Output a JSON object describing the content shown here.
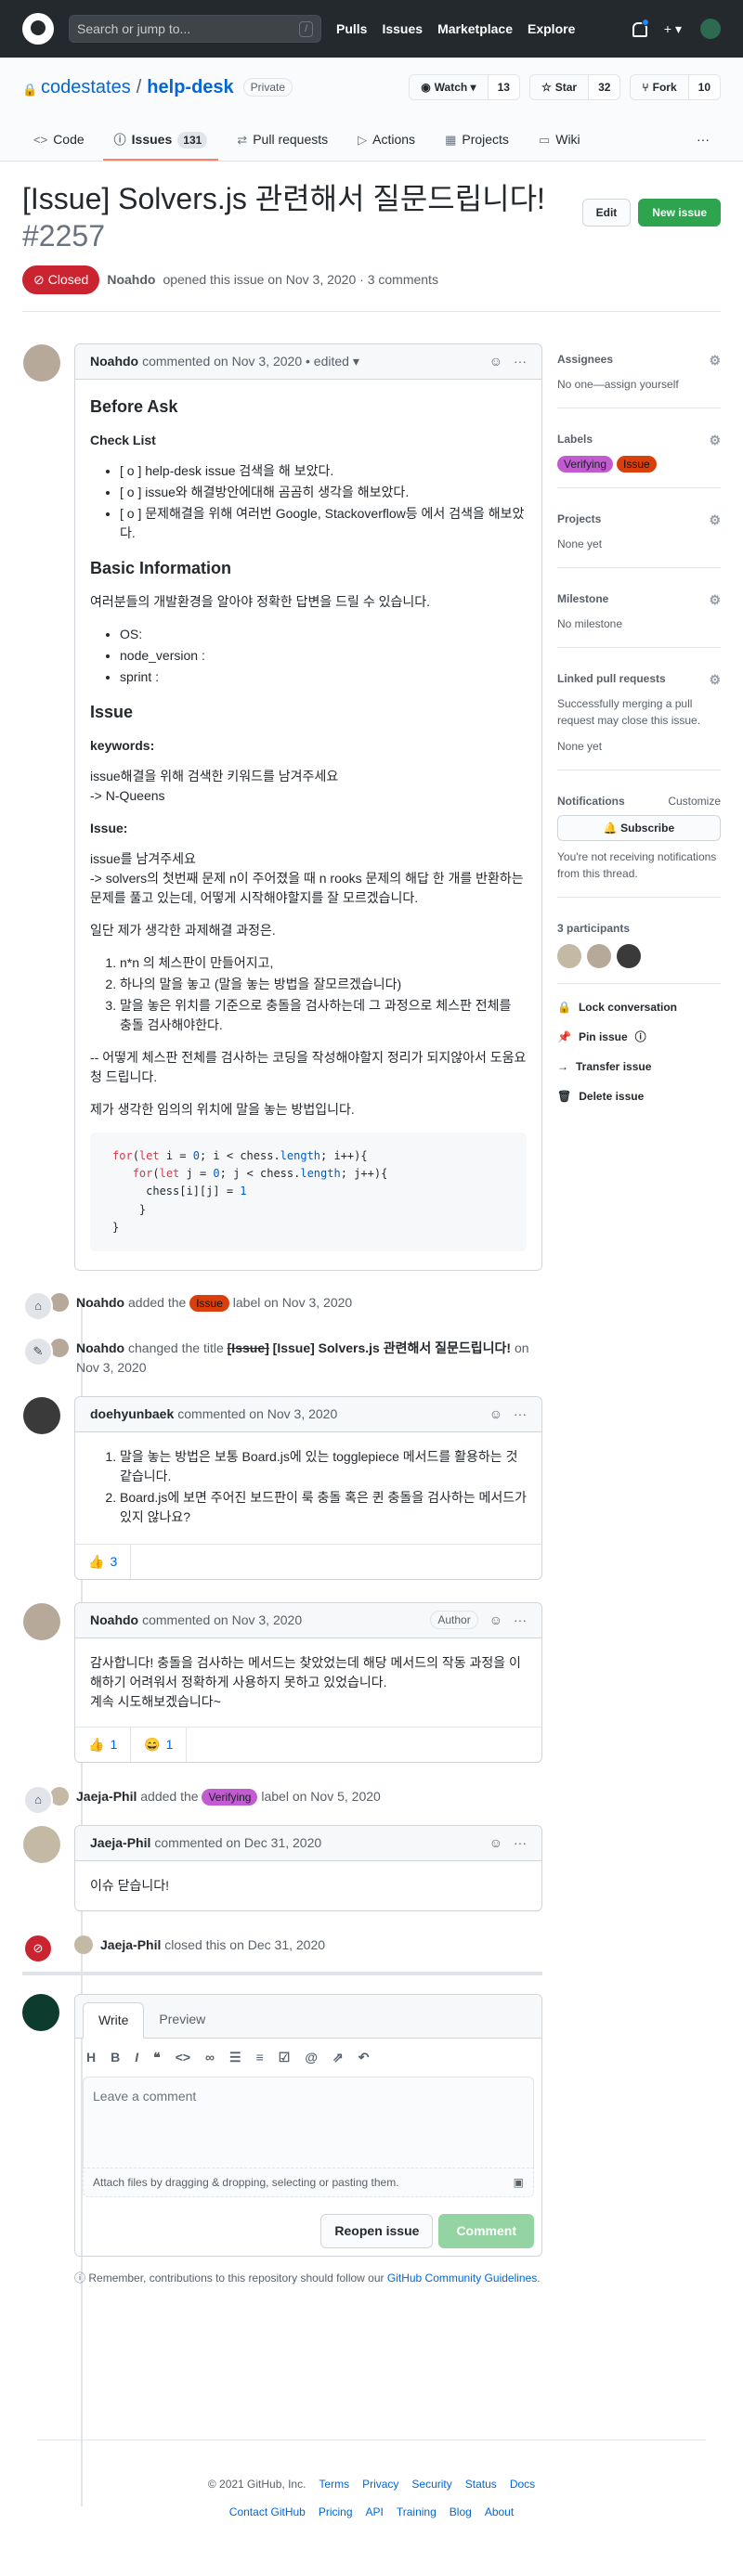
{
  "header": {
    "search_placeholder": "Search or jump to...",
    "slash_key": "/",
    "nav": [
      "Pulls",
      "Issues",
      "Marketplace",
      "Explore"
    ],
    "plus": "+ ▾"
  },
  "repo": {
    "owner": "codestates",
    "separator": "/",
    "name": "help-desk",
    "visibility": "Private",
    "watch_label": "Watch ▾",
    "watch_count": "13",
    "star_label": "Star",
    "star_count": "32",
    "fork_label": "Fork",
    "fork_count": "10",
    "tabs": [
      {
        "label": "Code"
      },
      {
        "label": "Issues",
        "count": "131"
      },
      {
        "label": "Pull requests"
      },
      {
        "label": "Actions"
      },
      {
        "label": "Projects"
      },
      {
        "label": "Wiki"
      }
    ],
    "more": "···"
  },
  "issue": {
    "title": "[Issue] Solvers.js 관련해서 질문드립니다!",
    "number": "#2257",
    "edit_label": "Edit",
    "new_issue_label": "New issue",
    "state": "Closed",
    "author": "Noahdo",
    "meta": "opened this issue on Nov 3, 2020 · 3 comments"
  },
  "first_comment": {
    "author": "Noahdo",
    "meta": "commented on Nov 3, 2020 • edited ▾",
    "h_before_ask": "Before Ask",
    "h_check_list": "Check List",
    "checklist": [
      "[ o ] help-desk issue 검색을 해 보았다.",
      "[ o ] issue와 해결방안에대해 곰곰히 생각을 해보았다.",
      "[ o ] 문제해결을 위해 여러번 Google, Stackoverflow등 에서 검색을 해보았다."
    ],
    "h_basic": "Basic Information",
    "basic_p": "여러분들의 개발환경을 알아야 정확한 답변을 드릴 수 있습니다.",
    "basic_items": [
      "OS:",
      "node_version :",
      "sprint :"
    ],
    "h_issue": "Issue",
    "keywords_label": "keywords:",
    "keywords_p1": "issue해결을 위해 검색한 키워드를 남겨주세요",
    "keywords_p2": "-> N-Queens",
    "issue_label": "Issue:",
    "issue_p1": "issue를 남겨주세요",
    "issue_p2": "-> solvers의 첫번째 문제 n이 주어졌을 때 n rooks 문제의 해답 한 개를 반환하는 문제를 풀고 있는데, 어떻게 시작해야할지를 잘 모르겠습니다.",
    "process_p": "일단 제가 생각한 과제해결 과정은.",
    "process_items": [
      "n*n 의 체스판이 만들어지고,",
      "하나의 말을 놓고 (말을 놓는 방법을 잘모르겠습니다)",
      "말을 놓은 위치를 기준으로 충돌을 검사하는데 그 과정으로 체스판 전체를 충돌 검사해야한다."
    ],
    "help_p": "-- 어떻게 체스판 전체를 검사하는 코딩을 작성해야할지 정리가 되지않아서 도움요청 드립니다.",
    "method_p": "제가 생각한 임의의 위치에 말을 놓는 방법입니다."
  },
  "events": {
    "label_added": {
      "actor": "Noahdo",
      "pre": "added the",
      "label": "Issue",
      "post": "label on Nov 3, 2020"
    },
    "title_changed": {
      "actor": "Noahdo",
      "pre": "changed the title",
      "old": "[Issue]",
      "new": "[Issue] Solvers.js 관련해서 질문드립니다!",
      "post": "on Nov 3, 2020"
    },
    "verifying_added": {
      "actor": "Jaeja-Phil",
      "pre": "added the",
      "label": "Verifying",
      "post": "label on Nov 5, 2020"
    },
    "closed": {
      "actor": "Jaeja-Phil",
      "text": "closed this on Dec 31, 2020"
    }
  },
  "comment2": {
    "author": "doehyunbaek",
    "meta": "commented on Nov 3, 2020",
    "items": [
      "말을 놓는 방법은 보통 Board.js에 있는 togglepiece 메서드를 활용하는 것 같습니다.",
      "Board.js에 보면 주어진 보드판이 룩 충돌 혹은 퀸 충돌을 검사하는 메서드가 있지 않나요?"
    ],
    "reaction_emoji": "👍",
    "reaction_count": "3"
  },
  "comment3": {
    "author": "Noahdo",
    "meta": "commented on Nov 3, 2020",
    "badge": "Author",
    "line1": "감사합니다! 충돌을 검사하는 메서드는 찾았었는데 해당 메서드의 작동 과정을 이해하기 어려워서 정확하게 사용하지 못하고 있었습니다.",
    "line2": "계속 시도해보겠습니다~",
    "reactions": [
      {
        "emoji": "👍",
        "count": "1"
      },
      {
        "emoji": "😄",
        "count": "1"
      }
    ]
  },
  "comment4": {
    "author": "Jaeja-Phil",
    "meta": "commented on Dec 31, 2020",
    "body": "이슈 닫습니다!"
  },
  "sidebar": {
    "assignees_title": "Assignees",
    "assignees_value": "No one—assign yourself",
    "labels_title": "Labels",
    "labels": [
      {
        "name": "Verifying",
        "color": "#c25bd1"
      },
      {
        "name": "Issue",
        "color": "#d93f0b"
      }
    ],
    "projects_title": "Projects",
    "projects_value": "None yet",
    "milestone_title": "Milestone",
    "milestone_value": "No milestone",
    "linked_title": "Linked pull requests",
    "linked_desc": "Successfully merging a pull request may close this issue.",
    "linked_value": "None yet",
    "notifications_title": "Notifications",
    "customize": "Customize",
    "subscribe": "Subscribe",
    "notif_desc": "You're not receiving notifications from this thread.",
    "participants_title": "3 participants",
    "lock": "Lock conversation",
    "pin": "Pin issue",
    "transfer": "Transfer issue",
    "delete": "Delete issue"
  },
  "composer": {
    "tab_write": "Write",
    "tab_preview": "Preview",
    "placeholder": "Leave a comment",
    "attach": "Attach files by dragging & dropping, selecting or pasting them.",
    "reopen": "Reopen issue",
    "comment": "Comment",
    "tip_pre": "Remember, contributions to this repository should follow our",
    "tip_link": "GitHub Community Guidelines",
    "tip_post": "."
  },
  "footer": {
    "copyright": "© 2021 GitHub, Inc.",
    "row1": [
      "Terms",
      "Privacy",
      "Security",
      "Status",
      "Docs"
    ],
    "row2": [
      "Contact GitHub",
      "Pricing",
      "API",
      "Training",
      "Blog",
      "About"
    ]
  },
  "colors": {
    "header_bg": "#24292e",
    "closed": "#cb2431",
    "green": "#2ea44f",
    "link": "#0366d6"
  }
}
